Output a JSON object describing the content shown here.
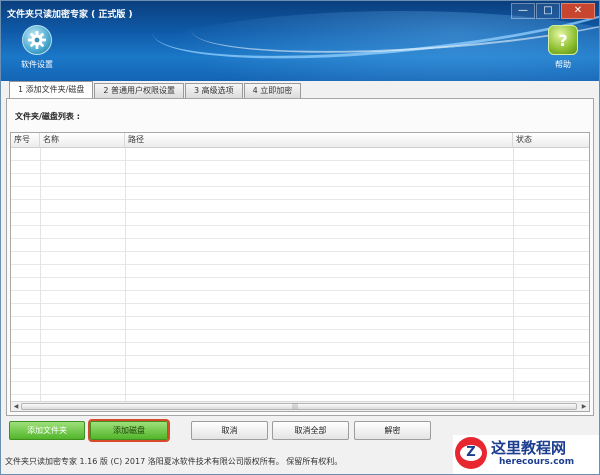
{
  "window": {
    "title": "文件夹只读加密专家 ( 正式版 )",
    "controls": {
      "minimize": "—",
      "maximize": "□",
      "close": "✕"
    }
  },
  "header": {
    "settings_label": "软件设置",
    "settings_icon": "gear-icon",
    "help_label": "帮助",
    "help_icon": "help-icon"
  },
  "tabs": [
    {
      "label": "1 添加文件夹/磁盘",
      "active": true
    },
    {
      "label": "2 普通用户权限设置",
      "active": false
    },
    {
      "label": "3 高级选项",
      "active": false
    },
    {
      "label": "4 立即加密",
      "active": false
    }
  ],
  "list": {
    "caption": "文件夹/磁盘列表 :",
    "columns": [
      "序号",
      "名称",
      "路径",
      "状态"
    ],
    "rows": []
  },
  "buttons": {
    "add_folder": "添加文件夹",
    "add_disk": "添加磁盘",
    "cancel": "取消",
    "cancel_all": "取消全部",
    "decrypt": "解密"
  },
  "status": "文件夹只读加密专家 1.16 版  (C) 2017 洛阳夏冰软件技术有限公司版权所有。 保留所有权利。",
  "watermark": {
    "title": "这里教程网",
    "url": "herecours.com",
    "logo_letter": "Z"
  },
  "colors": {
    "accent_green": "#52b52a",
    "highlight_border": "#d84a2a",
    "header_blue": "#0f5aa8"
  }
}
